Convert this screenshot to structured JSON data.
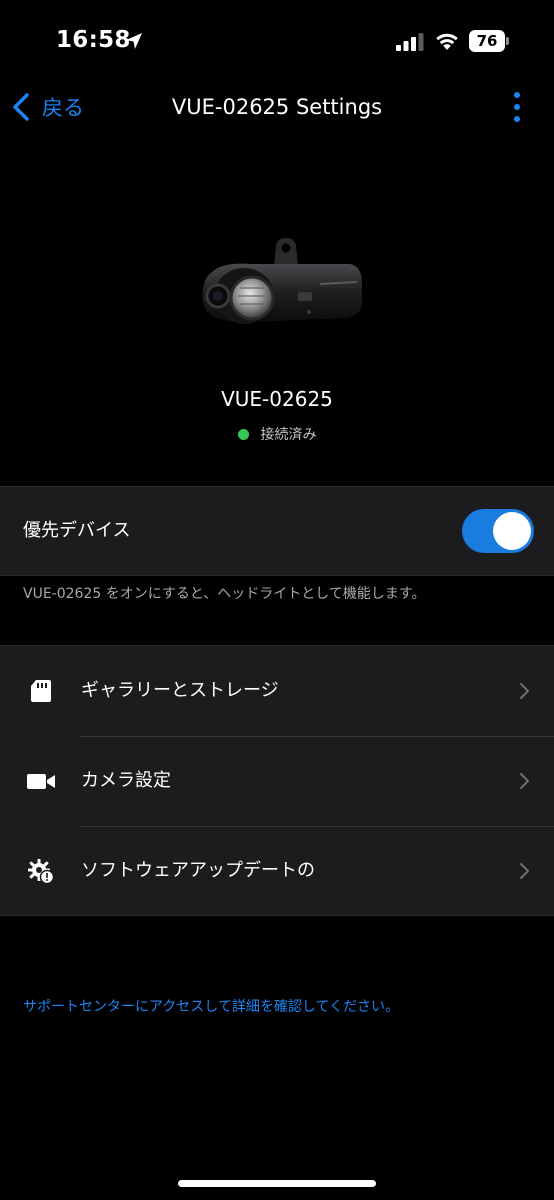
{
  "status_bar": {
    "time": "16:58",
    "battery_level": "76"
  },
  "nav": {
    "back_label": "戻る",
    "title": "VUE-02625 Settings"
  },
  "device": {
    "name": "VUE-02625",
    "status": "接続済み",
    "status_color": "#34c759"
  },
  "preferred": {
    "label": "優先デバイス",
    "enabled": true,
    "description": "VUE-02625 をオンにすると、ヘッドライトとして機能します。"
  },
  "menu": {
    "items": [
      {
        "label": "ギャラリーとストレージ",
        "icon": "sd-card-icon"
      },
      {
        "label": "カメラ設定",
        "icon": "video-camera-icon"
      },
      {
        "label": "ソフトウェアアップデートの",
        "icon": "gear-update-icon"
      }
    ]
  },
  "support": {
    "link_text": "サポートセンターにアクセスして詳細を確認してください。"
  },
  "colors": {
    "accent": "#1a84f5",
    "toggle_on": "#1b7ce0",
    "background": "#000000",
    "cell_background": "#1c1c1e"
  }
}
